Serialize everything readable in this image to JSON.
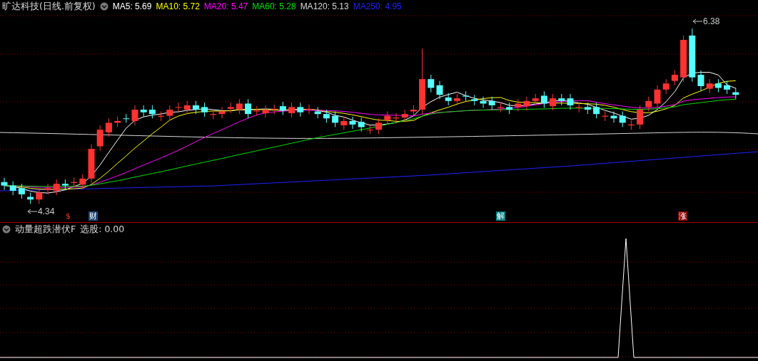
{
  "main_chart": {
    "title": "旷达科技(日线.前复权)",
    "moving_averages": [
      {
        "label": "MA5:",
        "value": "5.69",
        "color": "#ffffff"
      },
      {
        "label": "MA10:",
        "value": "5.72",
        "color": "#ffff00"
      },
      {
        "label": "MA20:",
        "value": "5.47",
        "color": "#ff00ff"
      },
      {
        "label": "MA60:",
        "value": "5.28",
        "color": "#00e000"
      },
      {
        "label": "MA120:",
        "value": "5.13",
        "color": "#d8d8d8"
      },
      {
        "label": "MA250:",
        "value": "4.95",
        "color": "#2020ff"
      }
    ],
    "high_label": "6.38",
    "low_label": "4.34",
    "markers": [
      {
        "text": "$",
        "kind": "symbol"
      },
      {
        "text": "财",
        "kind": "news"
      },
      {
        "text": "解",
        "kind": "unlock"
      },
      {
        "text": "涨",
        "kind": "limit"
      }
    ]
  },
  "indicator": {
    "title": "动量超跌潜伏F",
    "reading_label": "选股:",
    "reading": "0.00"
  }
}
